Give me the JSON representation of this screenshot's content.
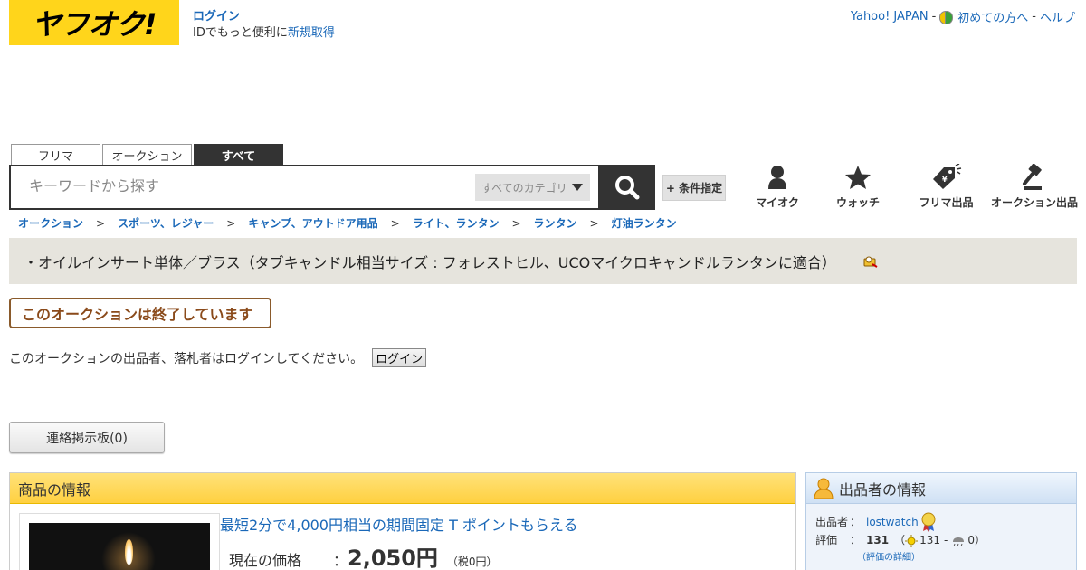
{
  "header": {
    "logo_text": "ヤフオク!",
    "login_label": "ログイン",
    "login_sub_prefix": "IDでもっと便利に",
    "register_label": "新規取得",
    "top_links": {
      "yahoo": "Yahoo! JAPAN",
      "beginner": "初めての方へ",
      "help": "ヘルプ",
      "sep": "-"
    }
  },
  "search": {
    "tabs": [
      "フリマ",
      "オークション",
      "すべて"
    ],
    "active_tab": "すべて",
    "placeholder": "キーワードから探す",
    "category": "すべてのカテゴリ",
    "condition_label": "+ 条件指定"
  },
  "nav": [
    {
      "label": "マイオク",
      "icon": "user-icon"
    },
    {
      "label": "ウォッチ",
      "icon": "star-icon"
    },
    {
      "label": "フリマ出品",
      "icon": "price-tag-icon"
    },
    {
      "label": "オークション出品",
      "icon": "gavel-icon"
    }
  ],
  "breadcrumb": [
    "オークション",
    "スポーツ、レジャー",
    "キャンプ、アウトドア用品",
    "ライト、ランタン",
    "ランタン",
    "灯油ランタン"
  ],
  "breadcrumb_sep": ">",
  "item": {
    "title": "・オイルインサート単体／ブラス（タブキャンドル相当サイズ : フォレストヒル、UCOマイクロキャンドルランタンに適合）",
    "ended_notice": "このオークションは終了しています",
    "login_notice": "このオークションの出品者、落札者はログインしてください。",
    "login_button": "ログイン",
    "board_button": "連絡掲示板(0)"
  },
  "product": {
    "header": "商品の情報",
    "promo": "最短2分で4,000円相当の期間固定 T ポイントもらえる",
    "price_label": "現在の価格",
    "colon": "：",
    "price": "2,050円",
    "tax": "（税0円）"
  },
  "seller": {
    "header": "出品者の情報",
    "seller_label": "出品者",
    "seller_name": "lostwatch",
    "rating_label": "評価",
    "colon": "：",
    "rating_total": "131",
    "rating_open": "（",
    "rating_good": "131",
    "rating_dash": "-",
    "rating_bad": "0",
    "rating_close": "）",
    "detail_link": "（評価の詳細）"
  },
  "colors": {
    "brand_yellow": "#ffd51b",
    "link": "#1a68b8",
    "dark": "#333333"
  }
}
